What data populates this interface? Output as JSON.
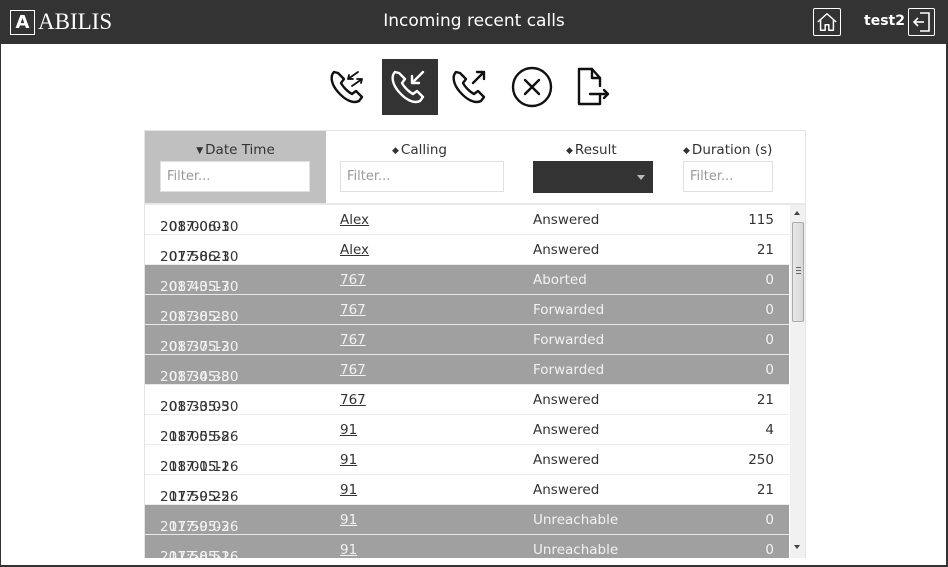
{
  "header": {
    "logo_letter": "A",
    "logo_text": "ABILIS",
    "title": "Incoming recent calls",
    "username": "test2",
    "icons": {
      "home": "home-icon",
      "logout": "logout-icon"
    }
  },
  "toolbar": {
    "buttons": [
      {
        "name": "all-calls",
        "icon": "phone-in-out-icon",
        "active": false
      },
      {
        "name": "incoming-calls",
        "icon": "phone-incoming-icon",
        "active": true
      },
      {
        "name": "outgoing-calls",
        "icon": "phone-outgoing-icon",
        "active": false
      },
      {
        "name": "clear",
        "icon": "circle-x-icon",
        "active": false
      },
      {
        "name": "export",
        "icon": "file-export-icon",
        "active": false
      }
    ]
  },
  "table": {
    "columns": [
      {
        "label": "Date Time",
        "sort": "▼",
        "filter_placeholder": "Filter..."
      },
      {
        "label": "Calling",
        "sort": "◆",
        "filter_placeholder": "Filter..."
      },
      {
        "label": "Result",
        "sort": "◆",
        "filter_value": ""
      },
      {
        "label": "Duration (s)",
        "sort": "◆",
        "filter_placeholder": "Filter..."
      }
    ],
    "rows": [
      {
        "date": "2017-06-30",
        "time": "08:00:01",
        "calling": "Alex",
        "result": "Answered",
        "duration": "115",
        "gray": false
      },
      {
        "date": "2017-06-30",
        "time": "07:58:21",
        "calling": "Alex",
        "result": "Answered",
        "duration": "21",
        "gray": false
      },
      {
        "date": "2017-05-30",
        "time": "08:43:17",
        "calling": "767",
        "result": "Aborted",
        "duration": "0",
        "gray": true
      },
      {
        "date": "2017-05-30",
        "time": "08:38:28",
        "calling": "767",
        "result": "Forwarded",
        "duration": "0",
        "gray": true
      },
      {
        "date": "2017-05-30",
        "time": "08:37:12",
        "calling": "767",
        "result": "Forwarded",
        "duration": "0",
        "gray": true
      },
      {
        "date": "2017-05-30",
        "time": "08:34:38",
        "calling": "767",
        "result": "Forwarded",
        "duration": "0",
        "gray": true
      },
      {
        "date": "2017-05-30",
        "time": "08:33:05",
        "calling": "767",
        "result": "Answered",
        "duration": "21",
        "gray": false
      },
      {
        "date": "2017-05-26",
        "time": "18:05:58",
        "calling": "91",
        "result": "Answered",
        "duration": "4",
        "gray": false
      },
      {
        "date": "2017-05-26",
        "time": "18:01:11",
        "calling": "91",
        "result": "Answered",
        "duration": "250",
        "gray": false
      },
      {
        "date": "2017-05-26",
        "time": "17:59:25",
        "calling": "91",
        "result": "Answered",
        "duration": "21",
        "gray": false
      },
      {
        "date": "2017-05-26",
        "time": "17:59:03",
        "calling": "91",
        "result": "Unreachable",
        "duration": "0",
        "gray": true
      },
      {
        "date": "2017-05-26",
        "time": "17:58:51",
        "calling": "91",
        "result": "Unreachable",
        "duration": "0",
        "gray": true
      }
    ]
  },
  "colors": {
    "topbar": "#333333",
    "sorted_header": "#c0c0c0",
    "row_gray": "#a0a0a0",
    "active_tool": "#333333"
  }
}
